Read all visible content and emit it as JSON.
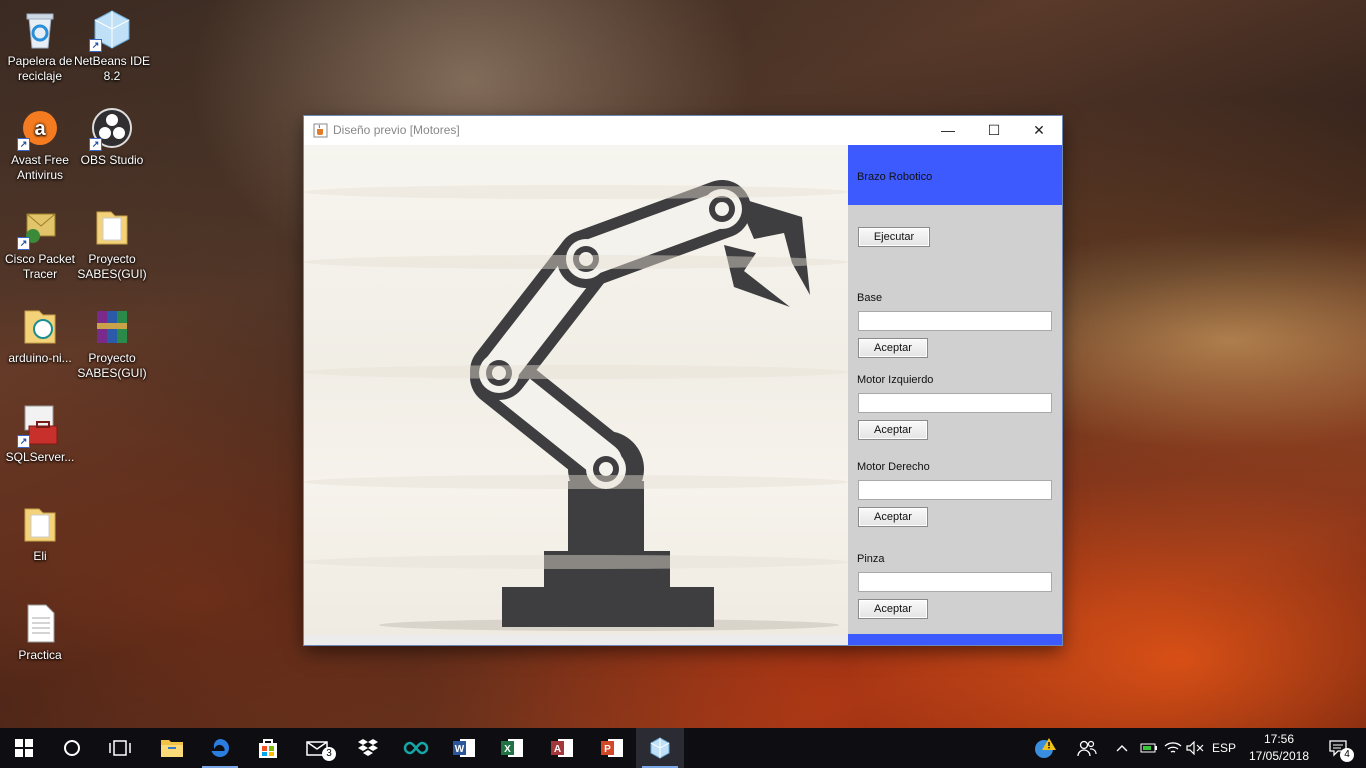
{
  "desktop": {
    "icons": [
      {
        "label": "Papelera de reciclaje",
        "icon": "recycle-bin-icon"
      },
      {
        "label": "NetBeans IDE 8.2",
        "icon": "netbeans-icon"
      },
      {
        "label": "Avast Free Antivirus",
        "icon": "avast-icon"
      },
      {
        "label": "OBS Studio",
        "icon": "obs-icon"
      },
      {
        "label": "Cisco Packet Tracer",
        "icon": "packet-tracer-icon"
      },
      {
        "label": "Proyecto SABES(GUI)",
        "icon": "folder-icon"
      },
      {
        "label": "arduino-ni...",
        "icon": "folder-icon"
      },
      {
        "label": "Proyecto SABES(GUI)",
        "icon": "rar-archive-icon"
      },
      {
        "label": "SQLServer...",
        "icon": "sql-server-icon"
      },
      {
        "label": "Eli",
        "icon": "folder-icon"
      },
      {
        "label": "Practica",
        "icon": "text-file-icon"
      }
    ]
  },
  "window": {
    "title": "Diseño previo [Motores]",
    "controls": {
      "minimize": "—",
      "maximize": "☐",
      "close": "✕"
    },
    "panel": {
      "heading": "Brazo Robotico",
      "execute_label": "Ejecutar",
      "fields": [
        {
          "label": "Base",
          "value": "",
          "button": "Aceptar"
        },
        {
          "label": "Motor Izquierdo",
          "value": "",
          "button": "Aceptar"
        },
        {
          "label": "Motor Derecho",
          "value": "",
          "button": "Aceptar"
        },
        {
          "label": "Pinza",
          "value": "",
          "button": "Aceptar"
        }
      ],
      "accent_color": "#3d5afe"
    }
  },
  "taskbar": {
    "apps": [
      {
        "name": "start-button",
        "icon": "windows-icon"
      },
      {
        "name": "cortana",
        "icon": "circle-icon"
      },
      {
        "name": "task-view",
        "icon": "task-view-icon"
      },
      {
        "name": "file-explorer",
        "icon": "folder-icon"
      },
      {
        "name": "edge",
        "icon": "edge-icon"
      },
      {
        "name": "store",
        "icon": "store-icon"
      },
      {
        "name": "mail",
        "icon": "mail-icon",
        "badge": "3"
      },
      {
        "name": "dropbox",
        "icon": "dropbox-icon"
      },
      {
        "name": "arduino",
        "icon": "arduino-icon"
      },
      {
        "name": "word",
        "icon": "word-icon"
      },
      {
        "name": "excel",
        "icon": "excel-icon"
      },
      {
        "name": "access",
        "icon": "access-icon"
      },
      {
        "name": "powerpoint",
        "icon": "powerpoint-icon"
      },
      {
        "name": "java-app",
        "icon": "java-window-icon"
      }
    ],
    "tray": {
      "language": "ESP",
      "time": "17:56",
      "date": "17/05/2018",
      "notification_count": "4"
    }
  }
}
